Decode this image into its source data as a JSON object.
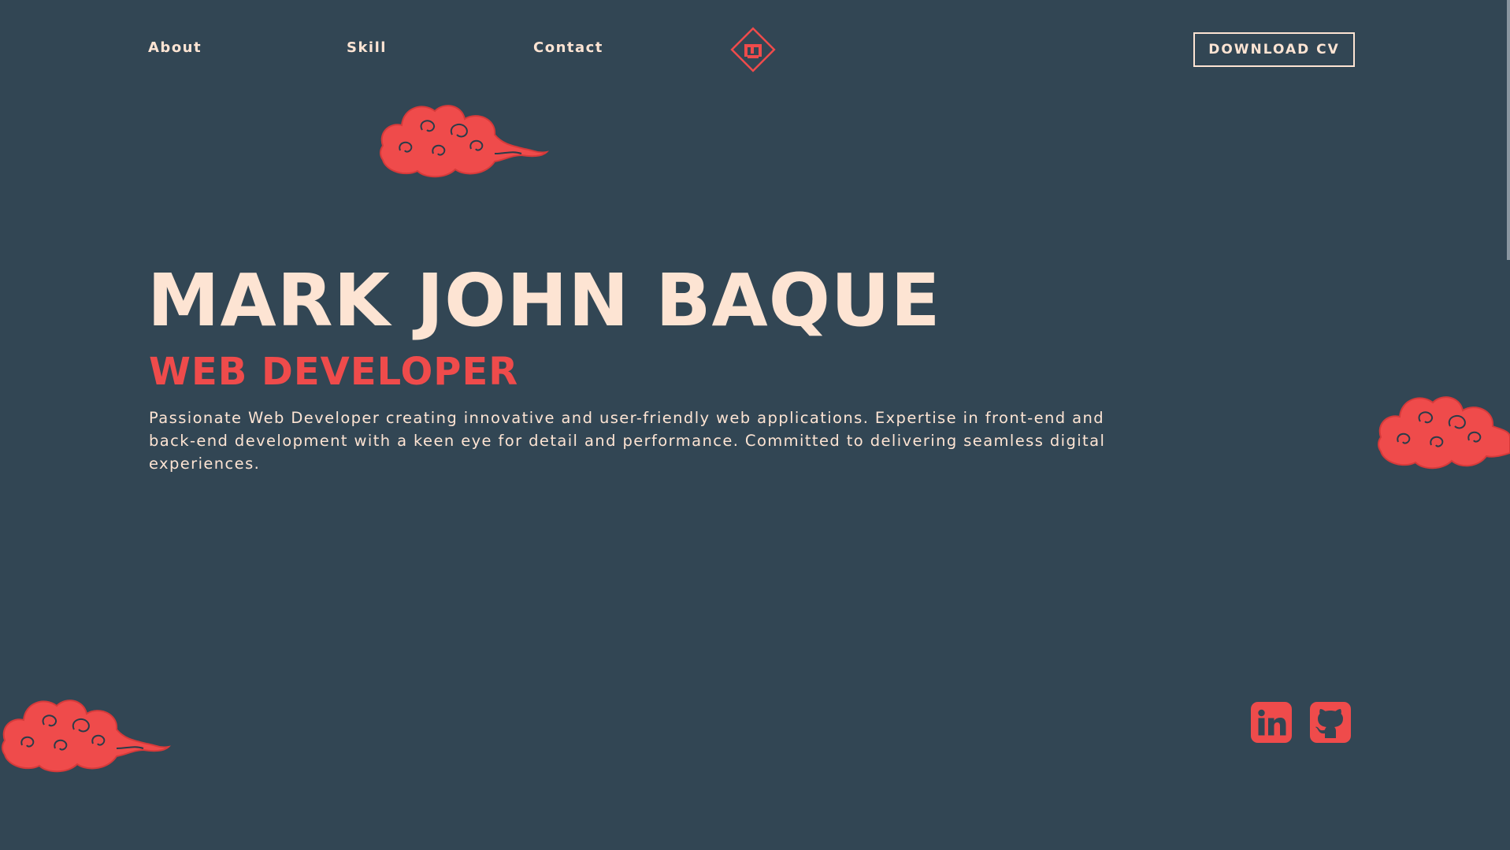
{
  "nav": {
    "links": [
      "About",
      "Skill",
      "Contact"
    ],
    "cv_button": "DOWNLOAD CV",
    "logo_icon": "diamond-monogram-logo-icon"
  },
  "hero": {
    "name": "MARK JOHN BAQUE",
    "role": "WEB DEVELOPER",
    "description": "Passionate Web Developer creating innovative and user-friendly web applications. Expertise in front-end and back-end development with a keen eye for detail and performance. Committed to delivering seamless digital experiences."
  },
  "social": {
    "icons": [
      "linkedin-icon",
      "github-icon"
    ]
  },
  "colors": {
    "background": "#324654",
    "accent": "#ef4b4b",
    "text": "#fde4d3"
  }
}
